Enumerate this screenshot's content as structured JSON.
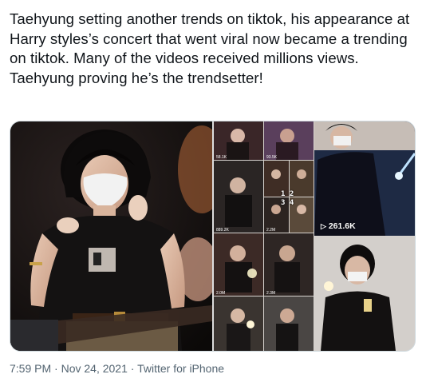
{
  "tweet": {
    "text": "Taehyung setting another trends on tiktok, his appearance at Harry styles’s concert that went viral now became a trending on tiktok. Many of the videos received millions views.\nTaehyung proving he’s the trendsetter!"
  },
  "media": {
    "grid_counts": {
      "c1": "58.1K",
      "c2": "93.5K",
      "c3": "889.2K",
      "c4": "2.2M",
      "c5": "2.0M",
      "c6": "2.3M"
    },
    "grid_numbers": {
      "row1": "1 2",
      "row2": "3 4"
    },
    "big_count": "261.6K"
  },
  "meta": {
    "time": "7:59 PM",
    "separator1": "·",
    "date": "Nov 24, 2021",
    "separator2": "·",
    "source": "Twitter for iPhone"
  }
}
